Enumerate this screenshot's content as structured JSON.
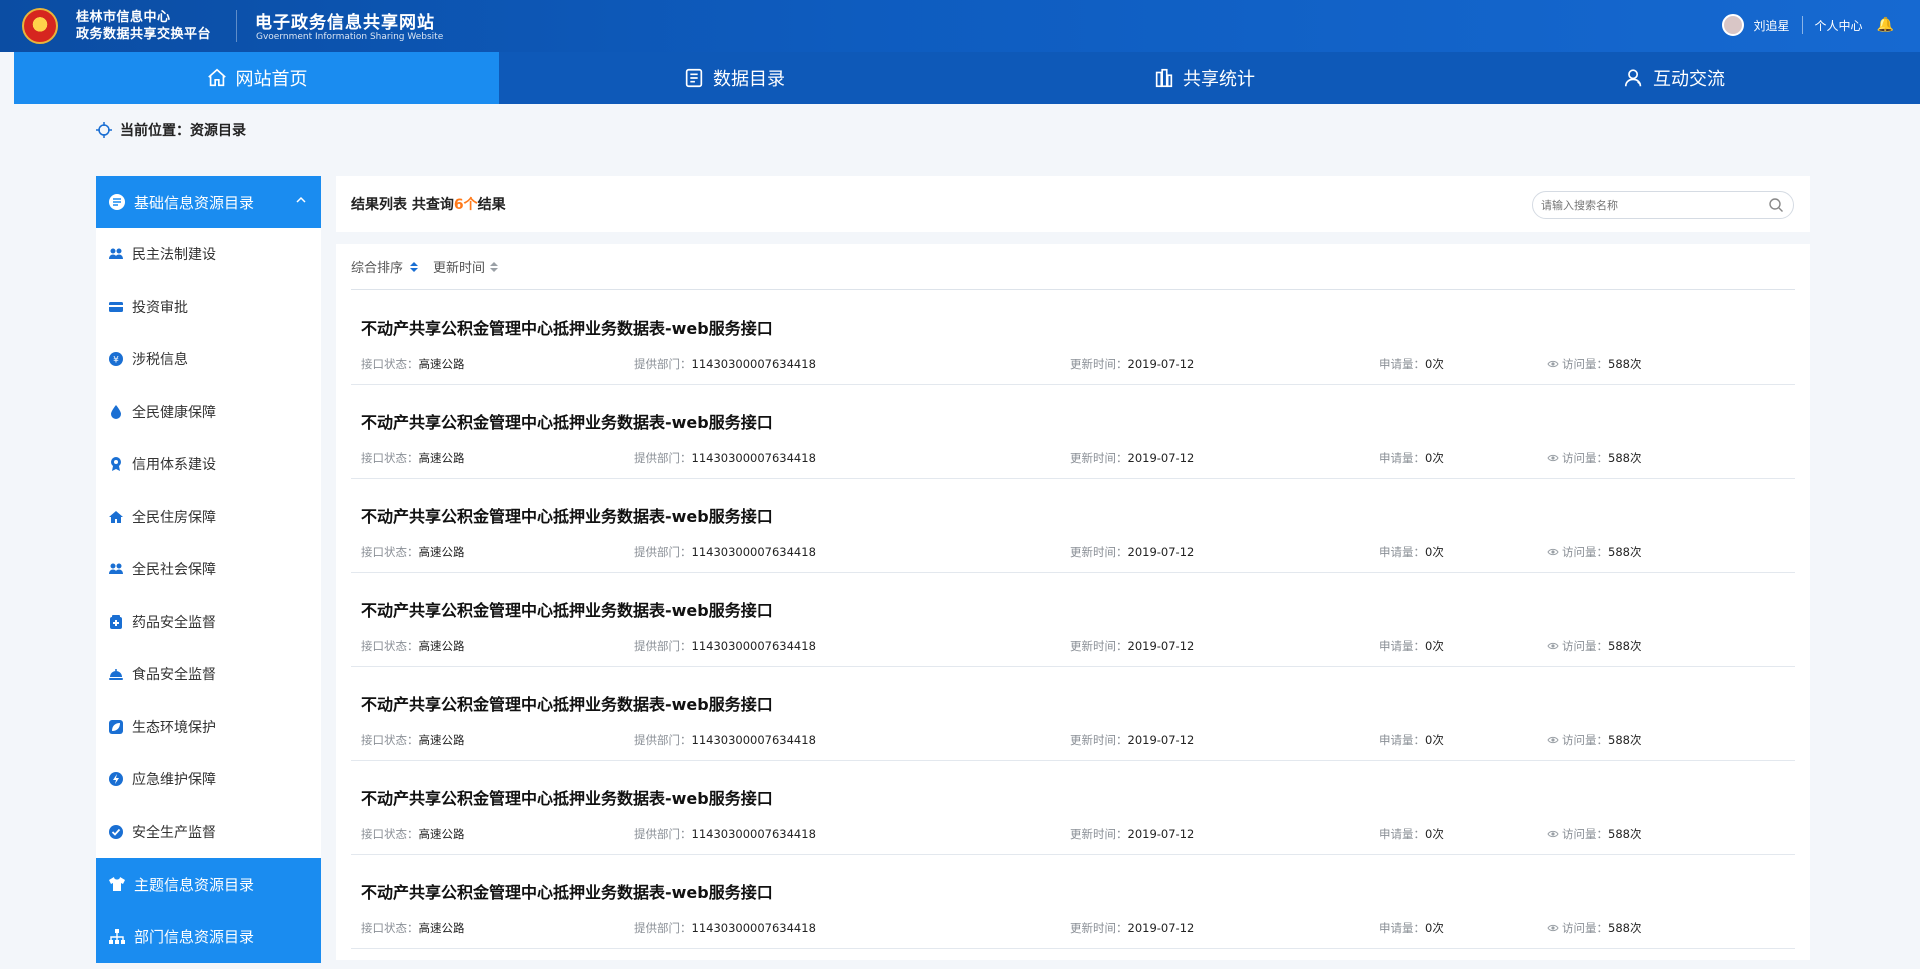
{
  "header": {
    "org_line1": "桂林市信息中心",
    "org_line2": "政务数据共享交换平台",
    "site_title": "电子政务信息共享网站",
    "site_subtitle": "Gvoernment Information Sharing Website",
    "username": "刘追星",
    "personal_center": "个人中心"
  },
  "nav": {
    "items": [
      {
        "label": "网站首页",
        "icon": "home-icon",
        "active": true
      },
      {
        "label": "数据目录",
        "icon": "catalog-icon",
        "active": false
      },
      {
        "label": "共享统计",
        "icon": "statistics-icon",
        "active": false
      },
      {
        "label": "互动交流",
        "icon": "user-chat-icon",
        "active": false
      }
    ]
  },
  "breadcrumb": {
    "text": "当前位置：资源目录"
  },
  "sidebar": {
    "top_group": "基础信息资源目录",
    "items": [
      {
        "label": "民主法制建设",
        "icon": "people-icon"
      },
      {
        "label": "投资审批",
        "icon": "card-icon"
      },
      {
        "label": "涉税信息",
        "icon": "tax-icon"
      },
      {
        "label": "全民健康保障",
        "icon": "drop-icon"
      },
      {
        "label": "信用体系建设",
        "icon": "badge-icon"
      },
      {
        "label": "全民住房保障",
        "icon": "house-icon"
      },
      {
        "label": "全民社会保障",
        "icon": "people-icon"
      },
      {
        "label": "药品安全监督",
        "icon": "medicine-icon"
      },
      {
        "label": "食品安全监督",
        "icon": "food-icon"
      },
      {
        "label": "生态环境保护",
        "icon": "leaf-icon"
      },
      {
        "label": "应急维护保障",
        "icon": "emergency-icon"
      },
      {
        "label": "安全生产监督",
        "icon": "shield-check-icon"
      }
    ],
    "bottom_groups": [
      {
        "label": "主题信息资源目录",
        "icon": "shirt-icon"
      },
      {
        "label": "部门信息资源目录",
        "icon": "org-chart-icon"
      }
    ]
  },
  "results": {
    "prefix": "结果列表 共查询",
    "count": "6个",
    "suffix": "结果",
    "search_placeholder": "请输入搜索名称"
  },
  "sort": {
    "items": [
      "综合排序",
      "更新时间"
    ]
  },
  "labels": {
    "status": "接口状态：",
    "dept": "提供部门：",
    "updated": "更新时间：",
    "applications": "申请量：",
    "visits": "访问量："
  },
  "list": [
    {
      "title": "不动产共享公积金管理中心抵押业务数据表-web服务接口",
      "status": "高速公路",
      "dept": "11430300007634418",
      "updated": "2019-07-12",
      "applications": "0次",
      "visits": "588次"
    },
    {
      "title": "不动产共享公积金管理中心抵押业务数据表-web服务接口",
      "status": "高速公路",
      "dept": "11430300007634418",
      "updated": "2019-07-12",
      "applications": "0次",
      "visits": "588次"
    },
    {
      "title": "不动产共享公积金管理中心抵押业务数据表-web服务接口",
      "status": "高速公路",
      "dept": "11430300007634418",
      "updated": "2019-07-12",
      "applications": "0次",
      "visits": "588次"
    },
    {
      "title": "不动产共享公积金管理中心抵押业务数据表-web服务接口",
      "status": "高速公路",
      "dept": "11430300007634418",
      "updated": "2019-07-12",
      "applications": "0次",
      "visits": "588次"
    },
    {
      "title": "不动产共享公积金管理中心抵押业务数据表-web服务接口",
      "status": "高速公路",
      "dept": "11430300007634418",
      "updated": "2019-07-12",
      "applications": "0次",
      "visits": "588次"
    },
    {
      "title": "不动产共享公积金管理中心抵押业务数据表-web服务接口",
      "status": "高速公路",
      "dept": "11430300007634418",
      "updated": "2019-07-12",
      "applications": "0次",
      "visits": "588次"
    },
    {
      "title": "不动产共享公积金管理中心抵押业务数据表-web服务接口",
      "status": "高速公路",
      "dept": "11430300007634418",
      "updated": "2019-07-12",
      "applications": "0次",
      "visits": "588次"
    }
  ],
  "colors": {
    "header_blue": "#0e59b8",
    "accent_blue": "#1a8cf0",
    "count_orange": "#ff7a1a",
    "notify_yellow": "#ffc83d"
  }
}
